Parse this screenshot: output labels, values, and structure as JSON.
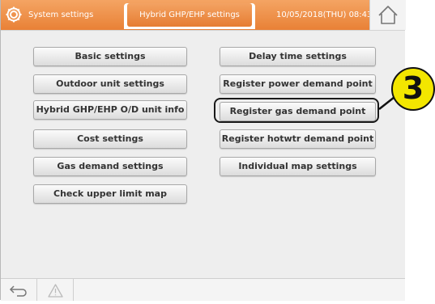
{
  "header": {
    "system_title": "System settings",
    "tab_label": "Hybrid GHP/EHP settings",
    "datetime": "10/05/2018(THU) 08:43"
  },
  "buttons": {
    "left": [
      "Basic settings",
      "Outdoor unit settings",
      "Hybrid GHP/EHP O/D unit info",
      "Cost settings",
      "Gas demand settings",
      "Check upper limit map"
    ],
    "right": [
      "Delay time settings",
      "Register power demand point",
      "Register gas demand point",
      "Register hotwtr demand point",
      "Individual map settings"
    ]
  },
  "callout": {
    "number": "3",
    "color": "#f3e600"
  },
  "icons": {
    "settings": "gear-icon",
    "home": "home-icon",
    "back": "back-arrow-icon",
    "alert": "warning-icon"
  },
  "colors": {
    "header_orange": "#e98136",
    "content_bg": "#eeeeee"
  }
}
